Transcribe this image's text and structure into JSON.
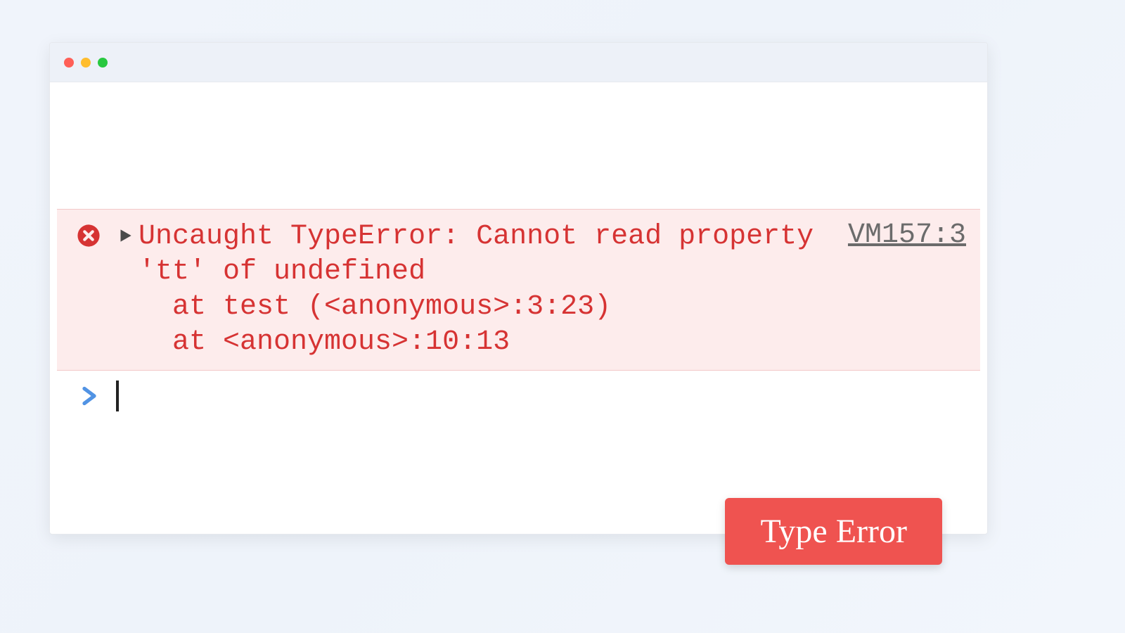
{
  "window": {
    "traffic_lights": [
      "close",
      "minimize",
      "zoom"
    ]
  },
  "console": {
    "error": {
      "message": "Uncaught TypeError: Cannot read property 'tt' of undefined",
      "stack": [
        "at test (<anonymous>:3:23)",
        "at <anonymous>:10:13"
      ],
      "source_link": "VM157:3"
    },
    "prompt": {
      "value": ""
    }
  },
  "badge": {
    "label": "Type Error"
  },
  "colors": {
    "error_text": "#d63333",
    "error_bg": "#fdecec",
    "prompt_blue": "#5193e4",
    "badge_bg": "#ef5350"
  }
}
